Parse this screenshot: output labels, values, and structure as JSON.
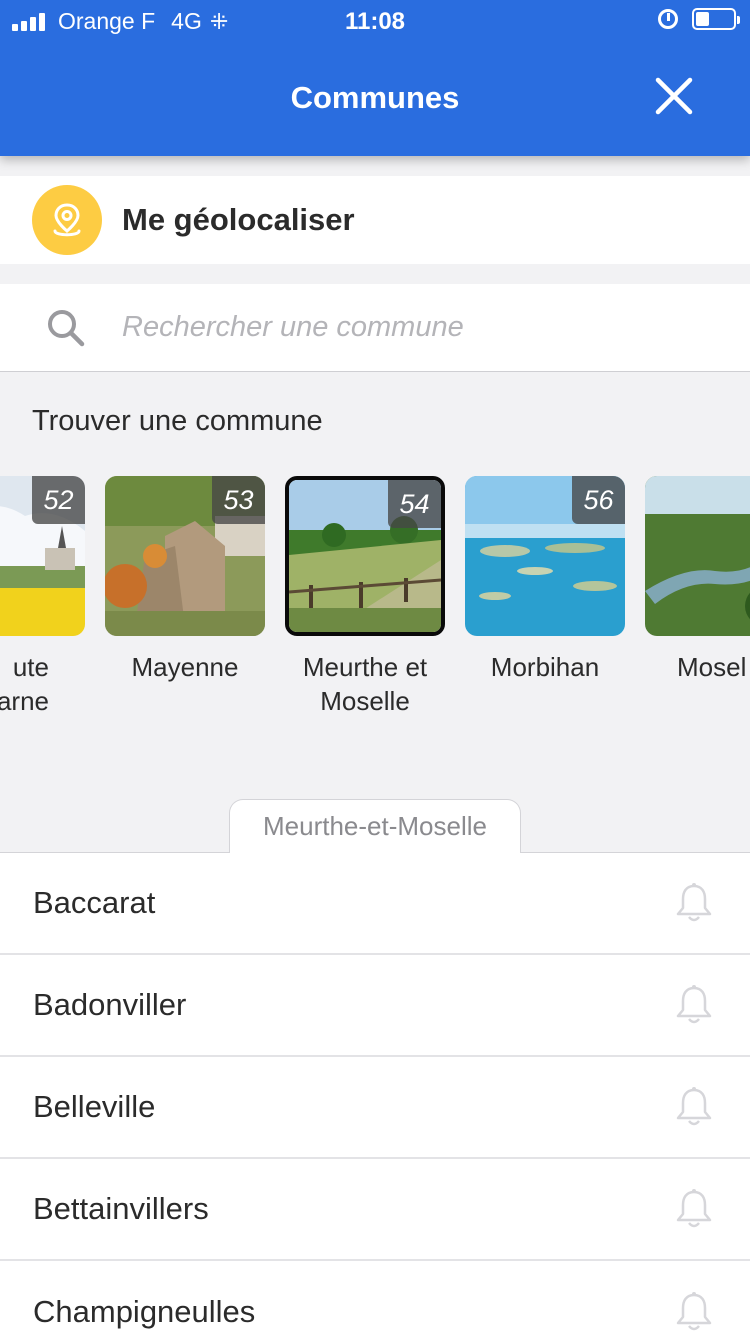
{
  "status_bar": {
    "carrier": "Orange F",
    "network": "4G",
    "time": "11:08",
    "battery_level": 0.35
  },
  "header": {
    "title": "Communes",
    "close_icon": "close-icon",
    "background_color": "#2a6ddf"
  },
  "geolocate": {
    "label": "Me géolocaliser",
    "icon": "location-pin-icon",
    "icon_bg": "#fdcc43"
  },
  "search": {
    "placeholder": "Rechercher une commune",
    "value": "",
    "icon": "search-icon"
  },
  "find_section": {
    "title": "Trouver une commune",
    "departments": [
      {
        "number": "52",
        "name": "Haute\nMarne",
        "visible_name": "ute\narne",
        "selected": false
      },
      {
        "number": "53",
        "name": "Mayenne",
        "selected": false
      },
      {
        "number": "54",
        "name": "Meurthe et\nMoselle",
        "selected": true
      },
      {
        "number": "56",
        "name": "Morbihan",
        "selected": false
      },
      {
        "number": "",
        "name": "Mosel",
        "selected": false
      }
    ]
  },
  "selected_tab": {
    "label": "Meurthe-et-Moselle"
  },
  "communes": [
    {
      "name": "Baccarat"
    },
    {
      "name": "Badonviller"
    },
    {
      "name": "Belleville"
    },
    {
      "name": "Bettainvillers"
    },
    {
      "name": "Champigneulles"
    }
  ]
}
